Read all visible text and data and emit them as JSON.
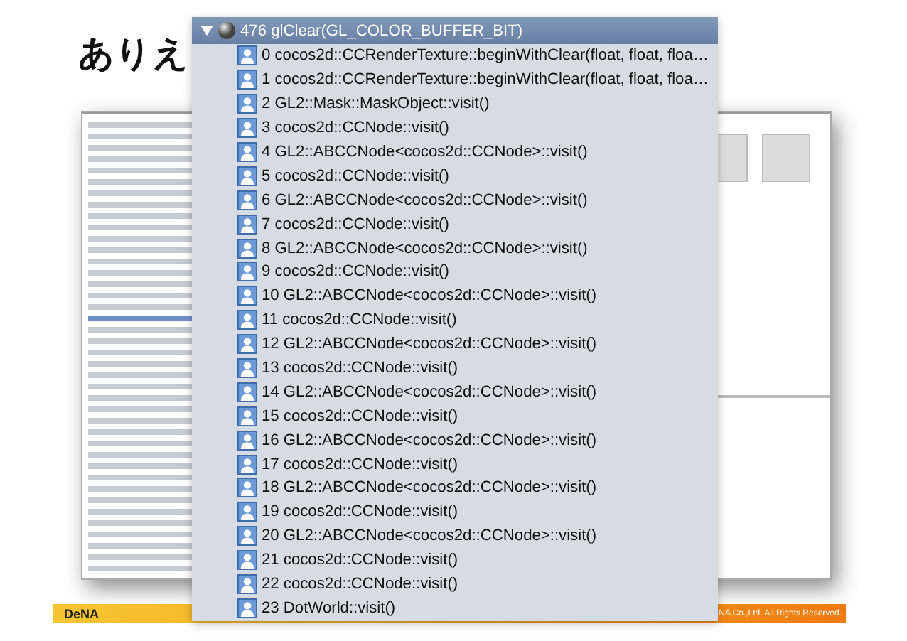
{
  "slide": {
    "title": "ありえ",
    "footer": {
      "logo": "DeNA",
      "copyright": "NA Co.,Ltd. All Rights Reserved."
    }
  },
  "call_tree": {
    "label": "476 glClear(GL_COLOR_BUFFER_BIT)",
    "expanded": true,
    "selected": true,
    "children": [
      {
        "label": "0 cocos2d::CCRenderTexture::beginWithClear(float, float, floa…",
        "selected": false
      },
      {
        "label": "1 cocos2d::CCRenderTexture::beginWithClear(float, float, floa…",
        "selected": false
      },
      {
        "label": "2 GL2::Mask::MaskObject::visit()",
        "selected": false
      },
      {
        "label": "3 cocos2d::CCNode::visit()",
        "selected": false
      },
      {
        "label": "4 GL2::ABCCNode<cocos2d::CCNode>::visit()",
        "selected": false
      },
      {
        "label": "5 cocos2d::CCNode::visit()",
        "selected": false
      },
      {
        "label": "6 GL2::ABCCNode<cocos2d::CCNode>::visit()",
        "selected": false
      },
      {
        "label": "7 cocos2d::CCNode::visit()",
        "selected": false
      },
      {
        "label": "8 GL2::ABCCNode<cocos2d::CCNode>::visit()",
        "selected": false
      },
      {
        "label": "9 cocos2d::CCNode::visit()",
        "selected": false
      },
      {
        "label": "10 GL2::ABCCNode<cocos2d::CCNode>::visit()",
        "selected": false
      },
      {
        "label": "11 cocos2d::CCNode::visit()",
        "selected": false
      },
      {
        "label": "12 GL2::ABCCNode<cocos2d::CCNode>::visit()",
        "selected": false
      },
      {
        "label": "13 cocos2d::CCNode::visit()",
        "selected": false
      },
      {
        "label": "14 GL2::ABCCNode<cocos2d::CCNode>::visit()",
        "selected": false
      },
      {
        "label": "15 cocos2d::CCNode::visit()",
        "selected": false
      },
      {
        "label": "16 GL2::ABCCNode<cocos2d::CCNode>::visit()",
        "selected": false
      },
      {
        "label": "17 cocos2d::CCNode::visit()",
        "selected": false
      },
      {
        "label": "18 GL2::ABCCNode<cocos2d::CCNode>::visit()",
        "selected": false
      },
      {
        "label": "19 cocos2d::CCNode::visit()",
        "selected": false
      },
      {
        "label": "20 GL2::ABCCNode<cocos2d::CCNode>::visit()",
        "selected": false
      },
      {
        "label": "21 cocos2d::CCNode::visit()",
        "selected": false
      },
      {
        "label": "22 cocos2d::CCNode::visit()",
        "selected": false
      },
      {
        "label": "23 DotWorld::visit()",
        "selected": false
      }
    ]
  }
}
